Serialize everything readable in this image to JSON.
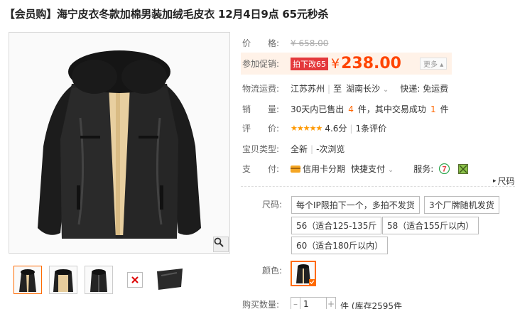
{
  "title": "【会员购】海宁皮衣冬款加棉男装加绒毛皮衣 12月4日9点 65元秒杀",
  "price": {
    "label": "价　　格:",
    "original": "¥ 658.00"
  },
  "promo": {
    "label": "参加促销:",
    "tag": "拍下改65",
    "currency": "¥",
    "price": "238.00",
    "more": "更多"
  },
  "shipping": {
    "label": "物流运费:",
    "from": "江苏苏州",
    "sep": "至",
    "to": "湖南长沙",
    "express": "快递: 免运费"
  },
  "sales": {
    "label": "销　　量:",
    "prefix": "30天内已售出",
    "sold": "4",
    "mid": "件，其中交易成功",
    "success": "1",
    "suffix": "件"
  },
  "rating": {
    "label": "评　　价:",
    "stars": "★★★★★",
    "score": "4.6分",
    "count": "1条评价"
  },
  "item_type": {
    "label": "宝贝类型:",
    "value": "全新",
    "views": "-次浏览"
  },
  "payment": {
    "label": "支　　付:",
    "credit": "信用卡分期",
    "quick": "快捷支付",
    "service_label": "服务:"
  },
  "size_tab": {
    "label": "尺码"
  },
  "sku": {
    "size_label": "尺码:",
    "sizes": [
      "每个IP限拍下一个，多拍不发货",
      "3个厂牌随机发货",
      "56（适合125-135斤",
      "58（适合155斤以内）",
      "60（适合180斤以内）"
    ],
    "color_label": "颜色:",
    "qty_label": "购买数量:",
    "qty_value": "1",
    "stock": "件 (库存2595件"
  },
  "icons": {
    "zoom": "magnifier-icon",
    "credit": "credit-card-icon",
    "service1": "seven-day-return-icon",
    "service2": "quality-guarantee-icon"
  },
  "colors": {
    "accent": "#ff4400",
    "promo_tag": "#e4393c",
    "selected_border": "#ff6a00"
  }
}
